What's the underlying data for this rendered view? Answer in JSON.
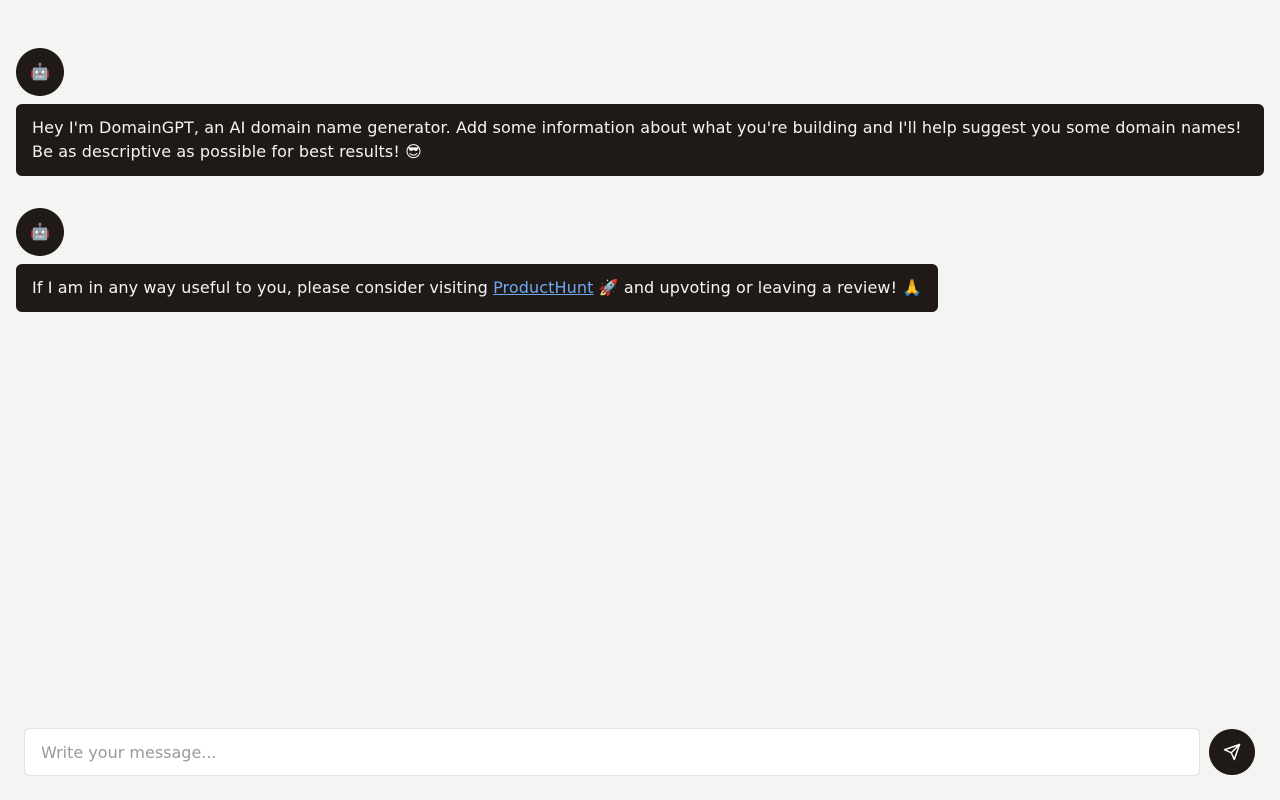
{
  "messages": [
    {
      "sender": "bot",
      "avatar_icon": "🤖",
      "line1": "Hey I'm DomainGPT, an AI domain name generator. Add some information about what you're building and I'll help suggest you some domain names!",
      "line2": "Be as descriptive as possible for best results! 😎"
    },
    {
      "sender": "bot",
      "avatar_icon": "🤖",
      "text_before_link": "If I am in any way useful to you, please consider visiting ",
      "link_text": "ProductHunt",
      "text_after_link": " 🚀 and upvoting or leaving a review! 🙏"
    }
  ],
  "composer": {
    "placeholder": "Write your message...",
    "send_icon": "paper-plane-icon"
  },
  "colors": {
    "background": "#f4f4f2",
    "bubble": "#1f1a17",
    "bubble_text": "#f4f4f2",
    "link": "#6ea8ef"
  }
}
